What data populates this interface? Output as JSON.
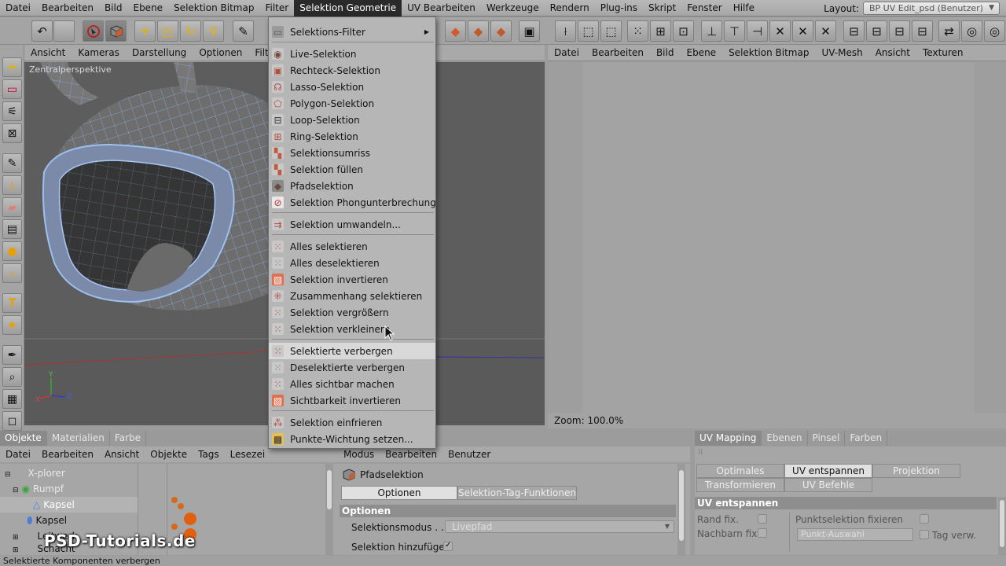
{
  "menubar": {
    "items": [
      "Datei",
      "Bearbeiten",
      "Bild",
      "Ebene",
      "Selektion Bitmap",
      "Filter",
      "Selektion Geometrie",
      "UV Bearbeiten",
      "Werkzeuge",
      "Rendern",
      "Plug-ins",
      "Skript",
      "Fenster",
      "Hilfe"
    ],
    "active_index": 6,
    "layout_label": "Layout:",
    "layout_value": "BP UV Edit_psd (Benutzer)"
  },
  "viewport": {
    "menu": [
      "Ansicht",
      "Kameras",
      "Darstellung",
      "Optionen",
      "Filter"
    ],
    "label": "Zentralperspektive"
  },
  "uv_editor": {
    "menu": [
      "Datei",
      "Bearbeiten",
      "Bild",
      "Ebene",
      "Selektion Bitmap",
      "UV-Mesh",
      "Ansicht",
      "Texturen"
    ],
    "zoom": "Zoom: 100.0%"
  },
  "dropdown": {
    "items": [
      {
        "label": "Selektions-Filter",
        "icon": "filter-icon",
        "submenu": true
      },
      {
        "label": "Live-Selektion",
        "icon": "live-selection-icon"
      },
      {
        "label": "Rechteck-Selektion",
        "icon": "rectangle-selection-icon"
      },
      {
        "label": "Lasso-Selektion",
        "icon": "lasso-selection-icon"
      },
      {
        "label": "Polygon-Selektion",
        "icon": "polygon-selection-icon"
      },
      {
        "label": "Loop-Selektion",
        "icon": "loop-selection-icon"
      },
      {
        "label": "Ring-Selektion",
        "icon": "ring-selection-icon"
      },
      {
        "label": "Selektionsumriss",
        "icon": "outline-selection-icon"
      },
      {
        "label": "Selektion füllen",
        "icon": "fill-selection-icon"
      },
      {
        "label": "Pfadselektion",
        "icon": "path-selection-icon"
      },
      {
        "label": "Selektion Phongunterbrechung",
        "icon": "phong-break-icon"
      },
      {
        "label": "Selektion umwandeln...",
        "icon": "convert-selection-icon"
      },
      {
        "label": "Alles selektieren",
        "icon": "select-all-icon"
      },
      {
        "label": "Alles deselektieren",
        "icon": "deselect-all-icon"
      },
      {
        "label": "Selektion invertieren",
        "icon": "invert-selection-icon"
      },
      {
        "label": "Zusammenhang selektieren",
        "icon": "select-connected-icon"
      },
      {
        "label": "Selektion vergrößern",
        "icon": "grow-selection-icon"
      },
      {
        "label": "Selektion verkleinern",
        "icon": "shrink-selection-icon"
      },
      {
        "label": "Selektierte verbergen",
        "icon": "hide-selected-icon"
      },
      {
        "label": "Deselektierte verbergen",
        "icon": "hide-unselected-icon"
      },
      {
        "label": "Alles sichtbar machen",
        "icon": "unhide-all-icon"
      },
      {
        "label": "Sichtbarkeit invertieren",
        "icon": "invert-visibility-icon"
      },
      {
        "label": "Selektion einfrieren",
        "icon": "freeze-selection-icon"
      },
      {
        "label": "Punkte-Wichtung setzen...",
        "icon": "vertex-weight-icon"
      }
    ]
  },
  "objects": {
    "tabs": [
      "Objekte",
      "Materialien",
      "Farbe"
    ],
    "menu": [
      "Datei",
      "Bearbeiten",
      "Ansicht",
      "Objekte",
      "Tags",
      "Lesezei"
    ],
    "rows": [
      "X-plorer",
      "Rumpf",
      "Kapsel",
      "Kapsel",
      "Leitwerk",
      "Schacht"
    ]
  },
  "attributes": {
    "menu": [
      "Modus",
      "Bearbeiten",
      "Benutzer"
    ],
    "title": "Pfadselektion",
    "tabs": [
      "Optionen",
      "Selektion-Tag-Funktionen"
    ],
    "section": "Optionen",
    "mode_label": "Selektionsmodus . . . .",
    "mode_value": "Livepfad",
    "add_label": "Selektion hinzufügen"
  },
  "uv_mapping": {
    "tabs": [
      "UV Mapping",
      "Ebenen",
      "Pinsel",
      "Farben"
    ],
    "buttons_row1": [
      "Optimales Mapping",
      "UV entspannen",
      "Projektion"
    ],
    "buttons_row2": [
      "Transformieren",
      "UV Befehle"
    ],
    "section": "UV entspannen",
    "rand_fix": "Rand fix.",
    "nachbarn_fix": "Nachbarn fix.",
    "punkt_fix": "Punktselektion fixieren",
    "punkt_auswahl": "Punkt-Auswahl",
    "tag_verw": "Tag verw."
  },
  "status": "Selektierte Komponenten verbergen",
  "watermark": "PSD-Tutorials.de"
}
